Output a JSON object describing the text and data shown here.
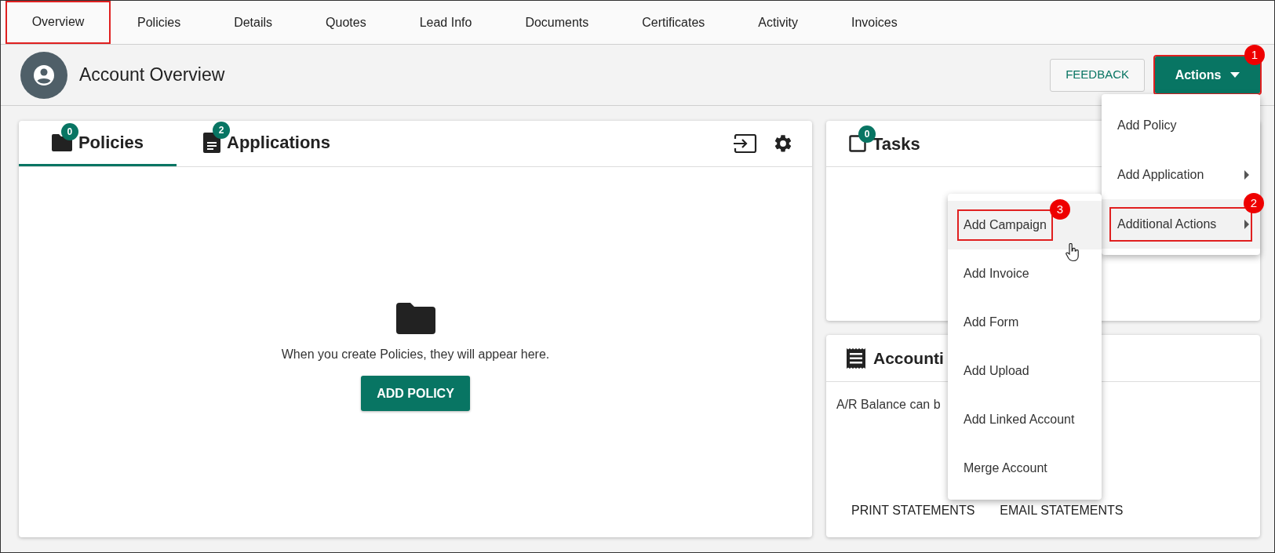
{
  "nav_tabs": [
    {
      "label": "Overview",
      "selected": true,
      "highlighted": true
    },
    {
      "label": "Policies",
      "selected": false,
      "highlighted": false
    },
    {
      "label": "Details",
      "selected": false,
      "highlighted": false
    },
    {
      "label": "Quotes",
      "selected": false,
      "highlighted": false
    },
    {
      "label": "Lead Info",
      "selected": false,
      "highlighted": false
    },
    {
      "label": "Documents",
      "selected": false,
      "highlighted": false
    },
    {
      "label": "Certificates",
      "selected": false,
      "highlighted": false
    },
    {
      "label": "Activity",
      "selected": false,
      "highlighted": false
    },
    {
      "label": "Invoices",
      "selected": false,
      "highlighted": false
    }
  ],
  "header": {
    "title": "Account Overview",
    "feedback_button": "FEEDBACK",
    "actions_button": {
      "label": "Actions",
      "highlighted": true,
      "callout": "1"
    }
  },
  "policies_card": {
    "tabs": [
      {
        "label": "Policies",
        "kind": "folder",
        "badge": "0",
        "selected": true
      },
      {
        "label": "Applications",
        "kind": "document",
        "badge": "2",
        "selected": false
      }
    ],
    "empty_message": "When you create Policies, they will appear here.",
    "add_button": "ADD POLICY"
  },
  "tasks_card": {
    "title": "Tasks",
    "badge": "0"
  },
  "accounting_card": {
    "title": "Accounti",
    "text": "A/R Balance can b",
    "buttons": [
      "PRINT STATEMENTS",
      "EMAIL STATEMENTS"
    ]
  },
  "actions_menu": [
    {
      "label": "Add Policy",
      "has_submenu": false,
      "hovered": false,
      "highlighted": false
    },
    {
      "label": "Add Application",
      "has_submenu": true,
      "hovered": false,
      "highlighted": false
    },
    {
      "label": "Additional Actions",
      "has_submenu": true,
      "hovered": true,
      "highlighted": true,
      "callout": "2"
    }
  ],
  "submenu": [
    {
      "label": "Add Campaign",
      "hovered": true,
      "highlighted": true,
      "callout": "3"
    },
    {
      "label": "Add Invoice",
      "hovered": false,
      "highlighted": false
    },
    {
      "label": "Add Form",
      "hovered": false,
      "highlighted": false
    },
    {
      "label": "Add Upload",
      "hovered": false,
      "highlighted": false
    },
    {
      "label": "Add Linked Account",
      "hovered": false,
      "highlighted": false
    },
    {
      "label": "Merge Account",
      "hovered": false,
      "highlighted": false
    }
  ]
}
